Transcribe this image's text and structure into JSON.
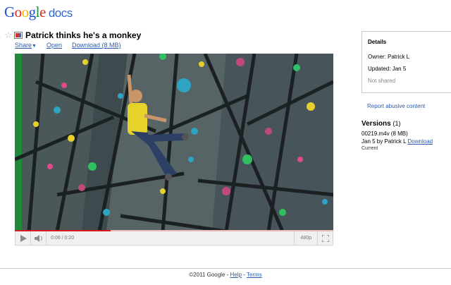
{
  "logo": {
    "g1": "G",
    "g2": "o",
    "g3": "o",
    "g4": "g",
    "g5": "l",
    "g6": "e",
    "product": "docs"
  },
  "document": {
    "title": "Patrick thinks he's a monkey"
  },
  "actions": {
    "share": "Share",
    "open": "Open",
    "download": "Download (8 MB)"
  },
  "player": {
    "time": "0:06 / 0:20",
    "quality": "480p",
    "progress": 0.3
  },
  "details": {
    "heading": "Details",
    "owner": "Owner: Patrick L",
    "updated": "Updated: Jan 5",
    "sharing": "Not shared"
  },
  "report_link": "Report abusive content",
  "versions": {
    "heading": "Versions",
    "count": "(1)",
    "filename": "00219.m4v (8 MB)",
    "by": "Jan 5 by Patrick L",
    "download": "Download",
    "current": "Current"
  },
  "footer": {
    "copyright": "©2011 Google",
    "sep1": " - ",
    "help": "Help",
    "sep2": " - ",
    "terms": "Terms"
  },
  "colors": {
    "link": "#2a5db0",
    "progress": "#d81a1a"
  }
}
